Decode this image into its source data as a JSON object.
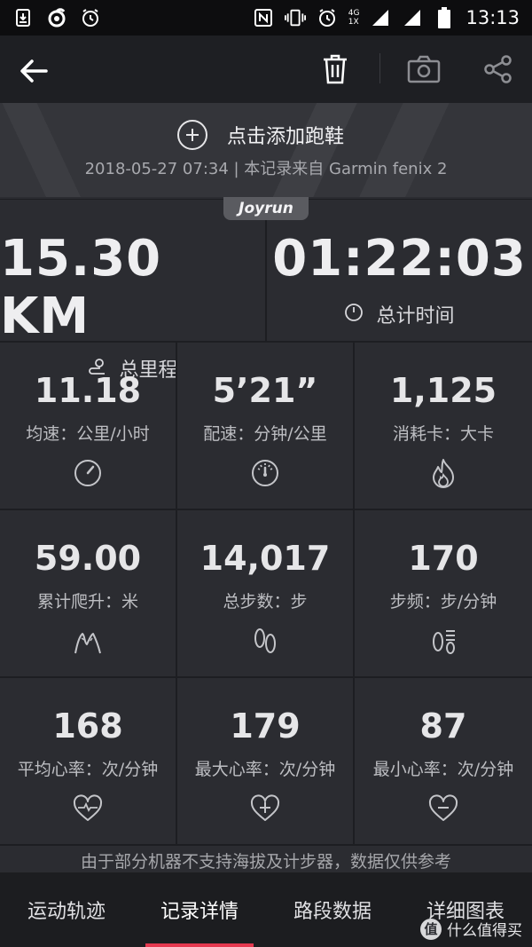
{
  "status_bar": {
    "time": "13:13",
    "network": "4G",
    "network_sub": "1X"
  },
  "toolbar": {
    "back_icon": "arrow-left-icon",
    "delete_icon": "trash-icon",
    "camera_icon": "camera-icon",
    "share_icon": "share-icon"
  },
  "header": {
    "add_shoes_label": "点击添加跑鞋",
    "record_meta": "2018-05-27 07:34 | 本记录来自 Garmin fenix 2",
    "brand": "Joyrun"
  },
  "summary": {
    "distance": {
      "value": "15.30 KM",
      "label": "总里程"
    },
    "duration": {
      "value": "01:22:03",
      "label": "总计时间"
    }
  },
  "metrics": [
    {
      "value": "11.18",
      "label": "均速：公里/小时",
      "icon": "speedometer-icon"
    },
    {
      "value": "5’21”",
      "label": "配速：分钟/公里",
      "icon": "pace-gauge-icon"
    },
    {
      "value": "1,125",
      "label": "消耗卡：大卡",
      "icon": "flame-icon"
    },
    {
      "value": "59.00",
      "label": "累计爬升：米",
      "icon": "mountain-icon"
    },
    {
      "value": "14,017",
      "label": "总步数：步",
      "icon": "footprints-icon"
    },
    {
      "value": "170",
      "label": "步频：步/分钟",
      "icon": "cadence-icon"
    },
    {
      "value": "168",
      "label": "平均心率：次/分钟",
      "icon": "heart-pulse-icon"
    },
    {
      "value": "179",
      "label": "最大心率：次/分钟",
      "icon": "heart-plus-icon"
    },
    {
      "value": "87",
      "label": "最小心率：次/分钟",
      "icon": "heart-minus-icon"
    }
  ],
  "notice": "由于部分机器不支持海拔及计步器，数据仅供参考",
  "tabs": [
    {
      "label": "运动轨迹",
      "active": false
    },
    {
      "label": "记录详情",
      "active": true
    },
    {
      "label": "路段数据",
      "active": false
    },
    {
      "label": "详细图表",
      "active": false
    }
  ],
  "watermark": {
    "badge": "值",
    "text": "什么值得买"
  },
  "colors": {
    "accent": "#e5384f",
    "background": "#2b2c31",
    "toolbar": "#1e1f23"
  }
}
